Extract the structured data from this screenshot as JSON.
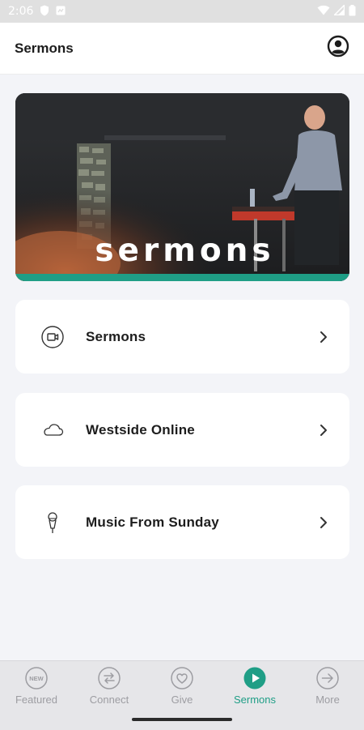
{
  "status_bar": {
    "time": "2:06"
  },
  "app_bar": {
    "title": "Sermons"
  },
  "hero": {
    "title": "sermons",
    "accent_color": "#1f9e86"
  },
  "menu": [
    {
      "label": "Sermons",
      "icon": "video-camera-icon"
    },
    {
      "label": "Westside Online",
      "icon": "cloud-icon"
    },
    {
      "label": "Music From Sunday",
      "icon": "microphone-icon"
    }
  ],
  "bottom_nav": {
    "active_color": "#1f9e86",
    "inactive_color": "#9d9da2",
    "items": [
      {
        "label": "Featured",
        "icon": "new-badge-icon",
        "icon_text": "NEW",
        "active": false
      },
      {
        "label": "Connect",
        "icon": "swap-arrows-icon",
        "active": false
      },
      {
        "label": "Give",
        "icon": "heart-icon",
        "active": false
      },
      {
        "label": "Sermons",
        "icon": "play-icon",
        "active": true
      },
      {
        "label": "More",
        "icon": "arrow-right-circle-icon",
        "active": false
      }
    ]
  }
}
